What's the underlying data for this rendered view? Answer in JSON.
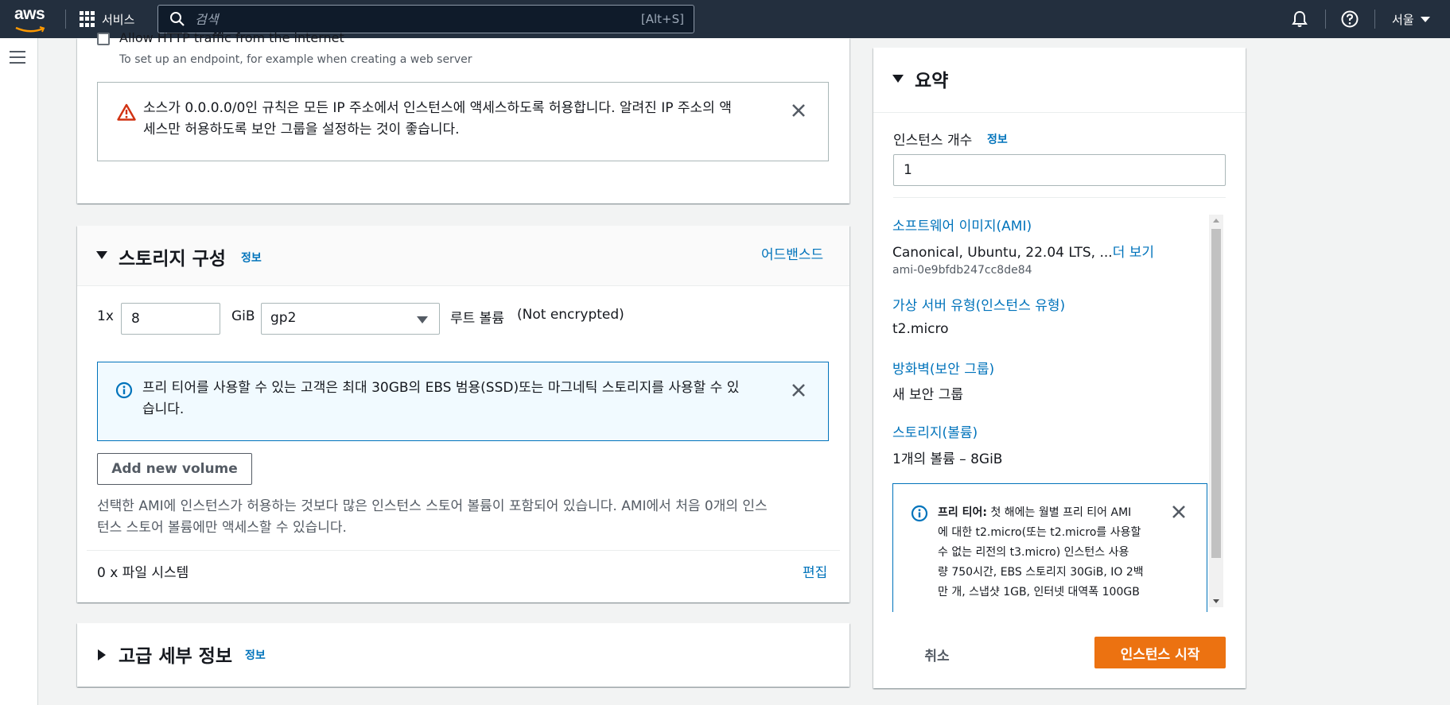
{
  "nav": {
    "logo": "aws",
    "services_label": "서비스",
    "search_placeholder": "검색",
    "search_shortcut": "[Alt+S]",
    "region_label": "서울"
  },
  "network": {
    "http_checkbox_label": "Allow HTTP traffic from the internet",
    "http_checkbox_checked": false,
    "http_checkbox_desc": "To set up an endpoint, for example when creating a web server",
    "warning_line1": "소스가 0.0.0.0/0인 규칙은 모든 IP 주소에서 인스턴스에 액세스하도록 허용합니다. 알려진 IP 주소의 액",
    "warning_line2": "세스만 허용하도록 보안 그룹을 설정하는 것이 좋습니다."
  },
  "storage": {
    "title": "스토리지 구성",
    "info_label": "정보",
    "advanced_link": "어드밴스드",
    "count_prefix": "1x",
    "size_value": "8",
    "size_unit": "GiB",
    "volume_type": "gp2",
    "root_volume_label": "루트 볼륨",
    "encryption_label": "(Not encrypted)",
    "free_tier_line1": "프리 티어를 사용할 수 있는 고객은 최대 30GB의 EBS 범용(SSD)또는 마그네틱 스토리지를 사용할 수 있",
    "free_tier_line2": "습니다.",
    "add_volume_label": "Add new volume",
    "instance_store_line1": "선택한 AMI에 인스턴스가 허용하는 것보다 많은 인스턴스 스토어 볼륨이 포함되어 있습니다. AMI에서 처음 0개의 인스",
    "instance_store_line2": "턴스 스토어 볼륨에만 액세스할 수 있습니다.",
    "filesystem_label": "0 x 파일 시스템",
    "edit_label": "편집"
  },
  "advanced": {
    "title": "고급 세부 정보",
    "info_label": "정보"
  },
  "summary": {
    "title": "요약",
    "instance_count_label": "인스턴스 개수",
    "info_label": "정보",
    "instance_count_value": "1",
    "ami_label": "소프트웨어 이미지(AMI)",
    "ami_value": "Canonical, Ubuntu, 22.04 LTS, ...",
    "ami_more": "더 보기",
    "ami_id": "ami-0e9bfdb247cc8de84",
    "instance_type_label": "가상 서버 유형(인스턴스 유형)",
    "instance_type_value": "t2.micro",
    "firewall_label": "방화벽(보안 그룹)",
    "firewall_value": "새 보안 그룹",
    "storage_label": "스토리지(볼륨)",
    "storage_value": "1개의 볼륨 – 8GiB",
    "free_tier_bold": "프리 티어:",
    "free_tier_line1": " 첫 해에는 월별 프리 티어 AMI",
    "free_tier_line2": "에 대한 t2.micro(또는 t2.micro를 사용할",
    "free_tier_line3": "수 없는 리전의 t3.micro) 인스턴스 사용",
    "free_tier_line4": "량 750시간, EBS 스토리지 30GiB, IO 2백",
    "free_tier_line5": "만 개, 스냅샷 1GB, 인터넷 대역폭 100GB",
    "cancel_label": "취소",
    "launch_label": "인스턴스 시작"
  },
  "colors": {
    "nav_bg": "#232f3e",
    "link": "#0073bb",
    "primary": "#ec7211",
    "warning": "#d13212"
  }
}
